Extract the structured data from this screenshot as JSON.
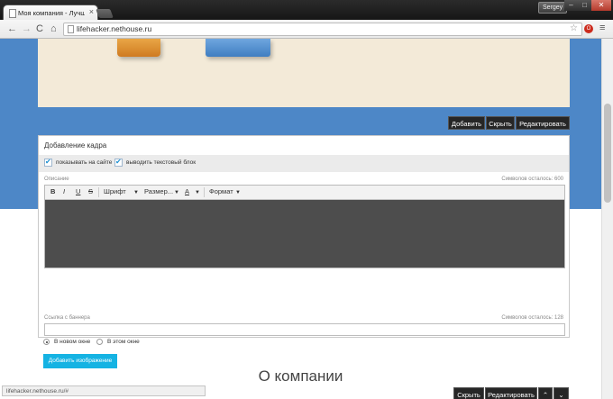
{
  "browser": {
    "tab_title": "Моя компания - Лучши",
    "tab_close": "×",
    "user": "Sergey",
    "min": "–",
    "max": "□",
    "close": "✕",
    "url": "lifehacker.nethouse.ru",
    "back": "←",
    "forward": "→",
    "reload": "C",
    "home": "⌂",
    "star": "☆",
    "menu": "≡",
    "ext": "O"
  },
  "hero_toolbar": {
    "add": "Добавить",
    "hide": "Скрыть",
    "edit": "Редактировать"
  },
  "form": {
    "title": "Добавление кадра",
    "show_on_site": "показывать на сайте",
    "show_text_block": "выводить текстовый блок",
    "description_label": "Описание",
    "description_count": "Символов осталось: 600",
    "editor": {
      "bold": "B",
      "italic": "I",
      "underline": "U",
      "strike": "S",
      "font": "Шрифт",
      "size": "Размер...",
      "color": "A",
      "format": "Формат",
      "arrow": "▼"
    },
    "banner_label": "Ссылка с баннера",
    "banner_count": "Символов осталось: 128",
    "radio_new_window": "В новом окне",
    "radio_this_window": "В этом окне",
    "add_image": "Добавить изображение"
  },
  "section_toolbar": {
    "hide": "Скрыть",
    "edit": "Редактировать",
    "up": "⌃",
    "down": "⌄"
  },
  "about_heading": "О компании",
  "status_url": "lifehacker.nethouse.ru/#"
}
